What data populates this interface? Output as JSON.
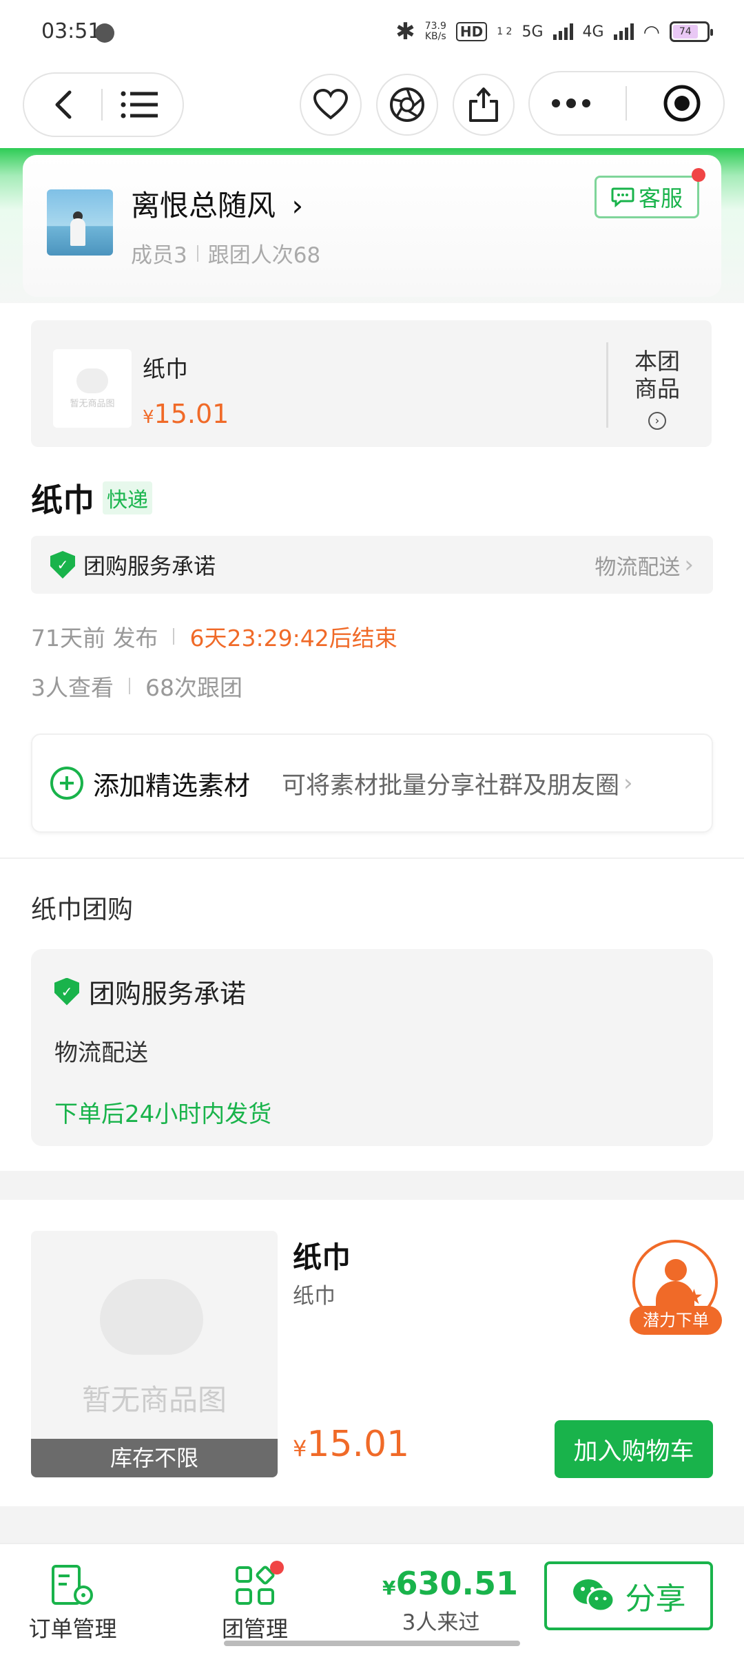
{
  "status_bar": {
    "time": "03:51",
    "net_speed_value": "73.9",
    "net_speed_unit": "KB/s",
    "hd_badge": "HD",
    "hd_sub": "1 2",
    "sig1": "5G",
    "sig2": "4G",
    "battery": "74"
  },
  "group": {
    "name": "离恨总随风",
    "members": "成员3",
    "follows": "跟团人次68",
    "cs_label": "客服"
  },
  "product_card": {
    "name": "纸巾",
    "price_symbol": "¥",
    "price": "15.01",
    "placeholder": "暂无商品图",
    "side_label_1": "本团",
    "side_label_2": "商品"
  },
  "title": {
    "text": "纸巾",
    "tag": "快递"
  },
  "service_bar": {
    "label": "团购服务承诺",
    "right": "物流配送"
  },
  "info": {
    "published": "71天前 发布",
    "countdown": "6天23:29:42后结束",
    "views": "3人查看",
    "joins": "68次跟团"
  },
  "material": {
    "title": "添加精选素材",
    "desc": "可将素材批量分享社群及朋友圈"
  },
  "section": {
    "title": "纸巾团购",
    "promise_title": "团购服务承诺",
    "promise_line1": "物流配送",
    "promise_line2": "下单后24小时内发货"
  },
  "item": {
    "name": "纸巾",
    "sub": "纸巾",
    "placeholder": "暂无商品图",
    "stock": "库存不限",
    "price_symbol": "¥",
    "price": "15.01",
    "cart_button": "加入购物车"
  },
  "float_button": {
    "label": "潜力下单"
  },
  "bottom_bar": {
    "orders": "订单管理",
    "group_mgmt": "团管理",
    "money_symbol": "¥",
    "money": "630.51",
    "visitors": "3人来过",
    "share": "分享"
  },
  "colors": {
    "brand_green": "#19b34b",
    "price_orange": "#f06a28"
  }
}
